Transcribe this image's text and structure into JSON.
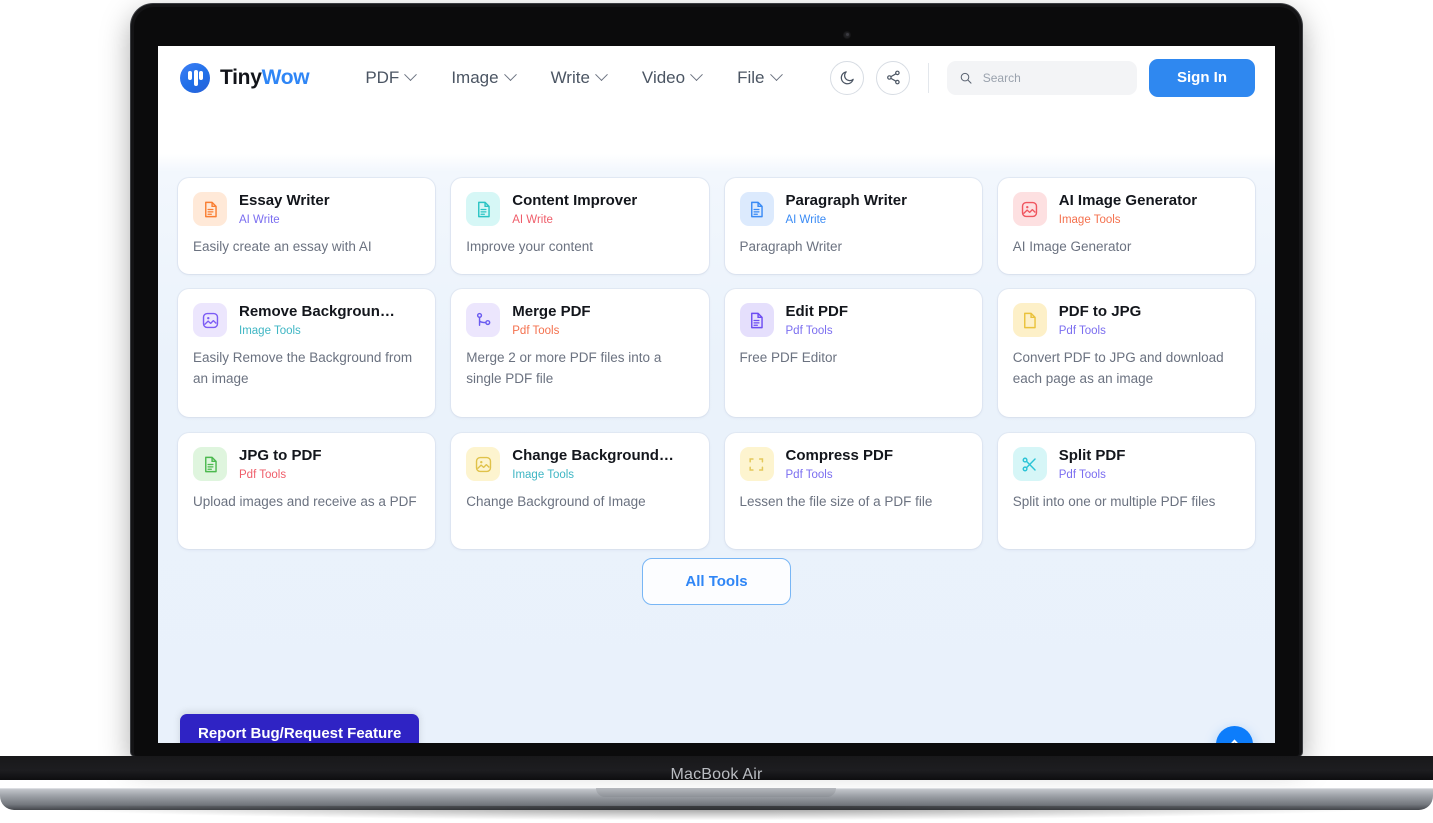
{
  "device": {
    "label": "MacBook Air"
  },
  "header": {
    "brand": {
      "name_prefix": "Tiny",
      "name_suffix": "Wow",
      "logo_icon": "tinywow-logo-icon"
    },
    "nav": [
      {
        "label": "PDF",
        "icon": "chevron-down-icon"
      },
      {
        "label": "Image",
        "icon": "chevron-down-icon"
      },
      {
        "label": "Write",
        "icon": "chevron-down-icon"
      },
      {
        "label": "Video",
        "icon": "chevron-down-icon"
      },
      {
        "label": "File",
        "icon": "chevron-down-icon"
      }
    ],
    "dark_mode_icon": "moon-icon",
    "share_icon": "share-icon",
    "search": {
      "placeholder": "Search",
      "value": "",
      "icon": "search-icon"
    },
    "sign_in_label": "Sign In",
    "accent_color": "#2f88f0"
  },
  "tools": [
    {
      "title": "Essay Writer",
      "category": "AI Write",
      "description": "Easily create an essay with AI",
      "icon": "document-lines-icon",
      "tile_bg": "#ffe9d8",
      "icon_color": "#f97e32",
      "cat_color": "#7b6ef0"
    },
    {
      "title": "Content Improver",
      "category": "AI Write",
      "description": "Improve your content",
      "icon": "document-lines-icon",
      "tile_bg": "#d6f7f6",
      "icon_color": "#2bc4c4",
      "cat_color": "#ef5d6a"
    },
    {
      "title": "Paragraph Writer",
      "category": "AI Write",
      "description": "Paragraph Writer",
      "icon": "document-lines-icon",
      "tile_bg": "#dceafd",
      "icon_color": "#3a8bf5",
      "cat_color": "#3a8bf5"
    },
    {
      "title": "AI Image Generator",
      "category": "Image Tools",
      "description": "AI Image Generator",
      "icon": "image-photo-icon",
      "tile_bg": "#fde0e1",
      "icon_color": "#f0565f",
      "cat_color": "#f4714e"
    },
    {
      "title": "Remove Backgroun…",
      "category": "Image Tools",
      "description": "Easily Remove the Background from an image",
      "icon": "image-photo-icon",
      "tile_bg": "#ece6fd",
      "icon_color": "#7c5cf5",
      "cat_color": "#3fb6c4"
    },
    {
      "title": "Merge PDF",
      "category": "Pdf Tools",
      "description": "Merge 2 or more PDF files into a single PDF file",
      "icon": "merge-nodes-icon",
      "tile_bg": "#ece6fd",
      "icon_color": "#6b5cf0",
      "cat_color": "#f4714e"
    },
    {
      "title": "Edit PDF",
      "category": "Pdf Tools",
      "description": "Free PDF Editor",
      "icon": "document-edit-icon",
      "tile_bg": "#e5dffc",
      "icon_color": "#6d4df2",
      "cat_color": "#7b6ef0"
    },
    {
      "title": "PDF to JPG",
      "category": "Pdf Tools",
      "description": "Convert PDF to JPG and download each page as an image",
      "icon": "document-blank-icon",
      "tile_bg": "#fdf0c8",
      "icon_color": "#eac23b",
      "cat_color": "#7b6ef0"
    },
    {
      "title": "JPG to PDF",
      "category": "Pdf Tools",
      "description": "Upload images and receive as a PDF",
      "icon": "document-lines-icon",
      "tile_bg": "#dff5de",
      "icon_color": "#4cb94f",
      "cat_color": "#ef5d6a"
    },
    {
      "title": "Change Background…",
      "category": "Image Tools",
      "description": "Change Background of Image",
      "icon": "image-photo-icon",
      "tile_bg": "#fdf4cf",
      "icon_color": "#e0c24a",
      "cat_color": "#3fb6c4"
    },
    {
      "title": "Compress PDF",
      "category": "Pdf Tools",
      "description": "Lessen the file size of a PDF file",
      "icon": "compress-corners-icon",
      "tile_bg": "#fdf4cf",
      "icon_color": "#e3c85a",
      "cat_color": "#7b6ef0"
    },
    {
      "title": "Split PDF",
      "category": "Pdf Tools",
      "description": "Split into one or multiple PDF files",
      "icon": "scissors-icon",
      "tile_bg": "#d6f6f7",
      "icon_color": "#2bc4d6",
      "cat_color": "#7b6ef0"
    }
  ],
  "all_tools_label": "All Tools",
  "report_button_label": "Report Bug/Request Feature",
  "scroll_top_icon": "chevron-up-icon"
}
